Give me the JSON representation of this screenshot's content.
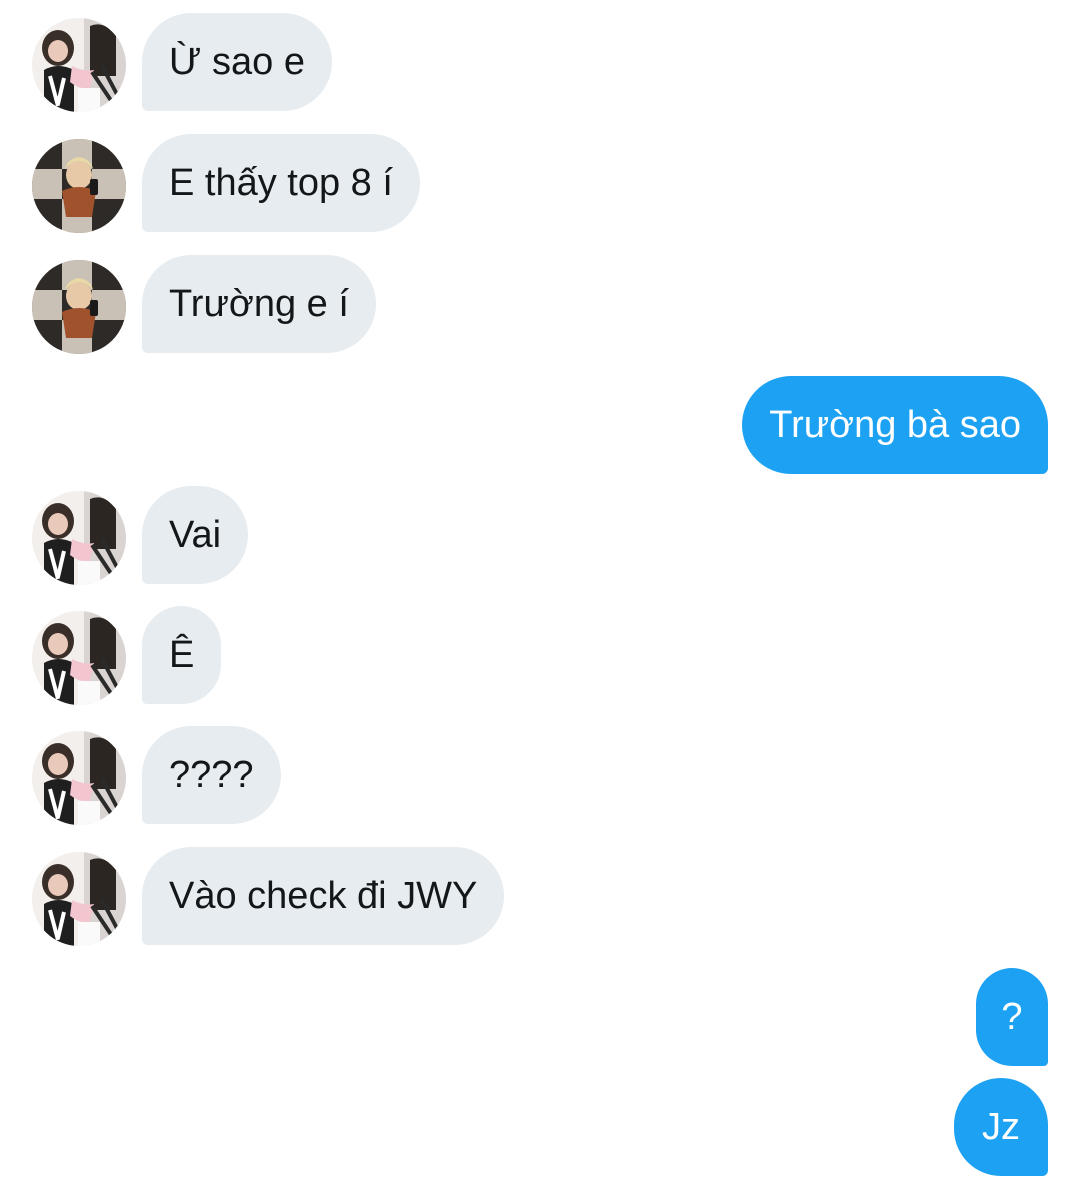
{
  "conversation": {
    "messages": [
      {
        "direction": "incoming",
        "avatar": "friend-photo-avatar",
        "text": "Ừ sao e"
      },
      {
        "direction": "incoming",
        "avatar": "friend-selfie-avatar",
        "text": "E thấy top 8 í"
      },
      {
        "direction": "incoming",
        "avatar": "friend-selfie-avatar",
        "text": "Trường e í"
      },
      {
        "direction": "outgoing",
        "text": "Trường bà sao"
      },
      {
        "direction": "incoming",
        "avatar": "friend-photo-avatar",
        "text": "Vai"
      },
      {
        "direction": "incoming",
        "avatar": "friend-photo-avatar",
        "text": "Ê"
      },
      {
        "direction": "incoming",
        "avatar": "friend-photo-avatar",
        "text": "????"
      },
      {
        "direction": "incoming",
        "avatar": "friend-photo-avatar",
        "text": "Vào check đi JWY"
      },
      {
        "direction": "outgoing",
        "text": "?"
      },
      {
        "direction": "outgoing",
        "text": "Jz"
      }
    ]
  },
  "colors": {
    "incoming_bubble": "#e6ecf0",
    "outgoing_bubble": "#1da1f2",
    "incoming_text": "#14171a",
    "outgoing_text": "#ffffff"
  }
}
